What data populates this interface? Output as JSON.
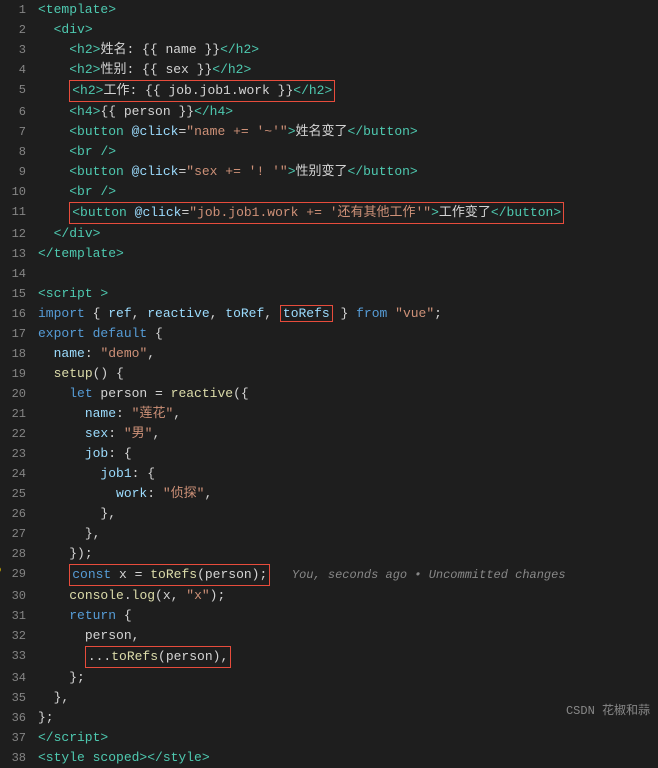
{
  "editor": {
    "lines": []
  },
  "footer": {
    "platform": "CSDN",
    "author": "花椒和蒜"
  }
}
